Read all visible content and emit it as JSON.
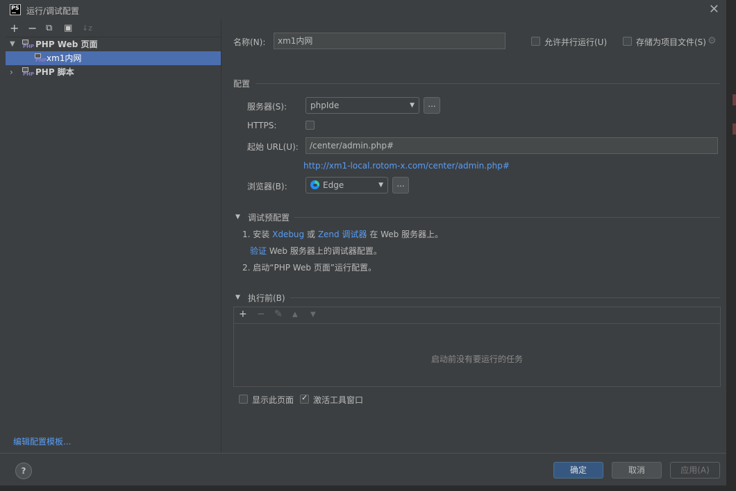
{
  "window": {
    "title": "运行/调试配置",
    "app_icon": "PS"
  },
  "toolbar": {
    "add": "+",
    "remove": "−",
    "copy": "⧉",
    "folder": "▣",
    "sort": "↓z"
  },
  "tree": {
    "groups": [
      {
        "label": "PHP Web 页面",
        "expanded": true,
        "children": [
          {
            "label": "xm1内网",
            "selected": true
          }
        ]
      },
      {
        "label": "PHP 脚本",
        "expanded": false,
        "children": []
      }
    ],
    "php_badge": "PHP"
  },
  "edit_templates": "编辑配置模板...",
  "form": {
    "name_label": "名称(N):",
    "name_value": "xm1内网",
    "allow_parallel": "允许并行运行(U)",
    "store_as_file": "存储为项目文件(S)",
    "config_section": "配置",
    "server_label": "服务器(S):",
    "server_value": "phpIde",
    "ellipsis": "...",
    "https_label": "HTTPS:",
    "start_url_label": "起始 URL(U):",
    "start_url_value": "/center/admin.php#",
    "full_url": "http://xm1-local.rotom-x.com/center/admin.php#",
    "browser_label": "浏览器(B):",
    "browser_value": "Edge"
  },
  "debug": {
    "title": "调试预配置",
    "step1_prefix": "1. 安装",
    "xdebug": "Xdebug",
    "or": "或",
    "zend": "Zend 调试器",
    "step1_suffix": "在 Web 服务器上。",
    "verify": "验证",
    "verify_suffix": "Web 服务器上的调试器配置。",
    "step2": "2. 启动“PHP Web 页面”运行配置。"
  },
  "before": {
    "title": "执行前(B)",
    "empty": "启动前没有要运行的任务",
    "show_page": "显示此页面",
    "activate_tool": "激活工具窗口"
  },
  "buttons": {
    "help": "?",
    "ok": "确定",
    "cancel": "取消",
    "apply": "应用(A)"
  }
}
